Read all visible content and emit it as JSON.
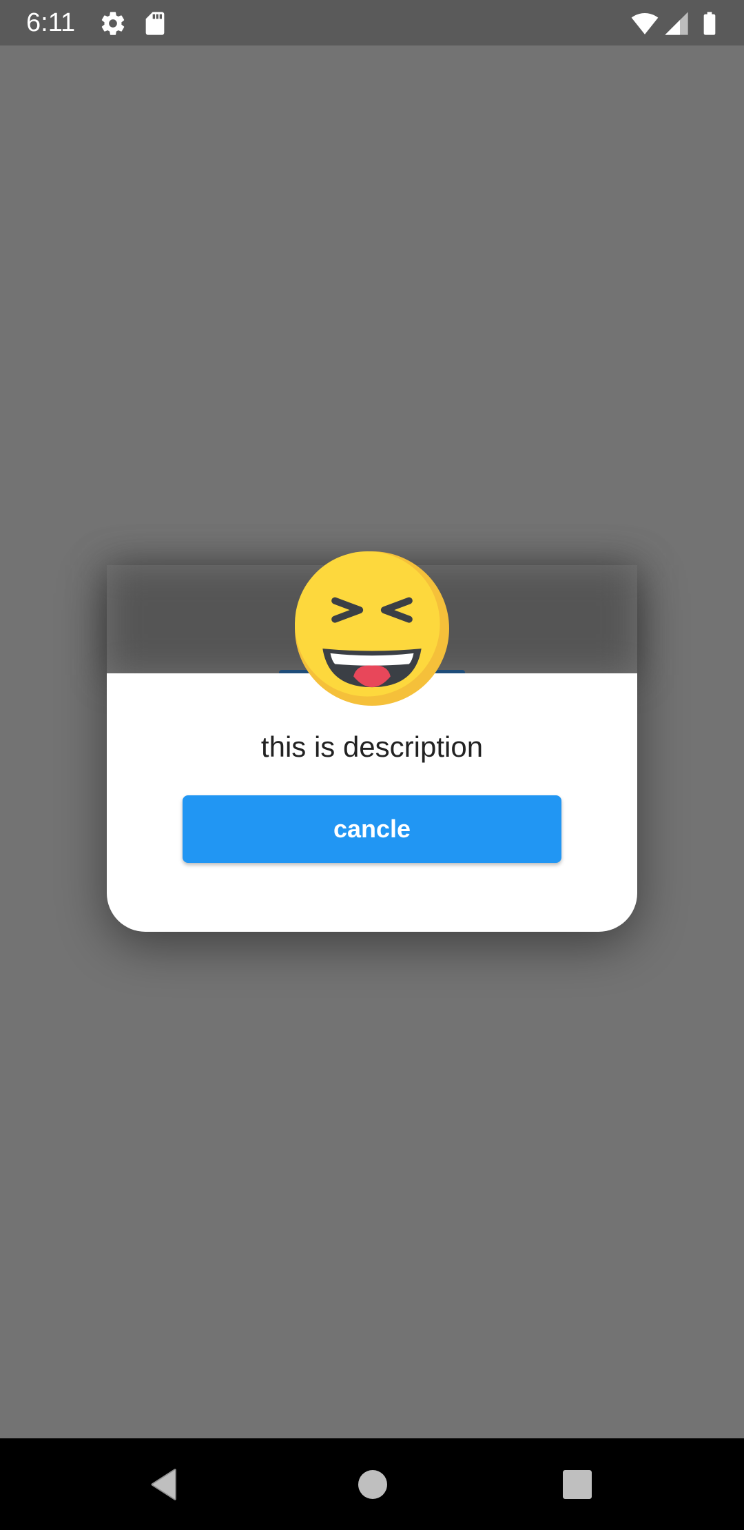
{
  "status_bar": {
    "time": "6:11",
    "icons": [
      "gear-icon",
      "sd-card-icon",
      "wifi-icon",
      "signal-icon",
      "battery-icon"
    ]
  },
  "dialog": {
    "emoji_icon": "laughing-face-icon",
    "description": "this is description",
    "button_label": "cancle"
  },
  "nav_bar": {
    "icons": [
      "back-icon",
      "home-icon",
      "recents-icon"
    ]
  },
  "colors": {
    "scrim": "#737373",
    "status_bar": "#5a5a5a",
    "button": "#2196f3",
    "emoji_face": "#fdd83d",
    "nav_bar": "#000000"
  }
}
